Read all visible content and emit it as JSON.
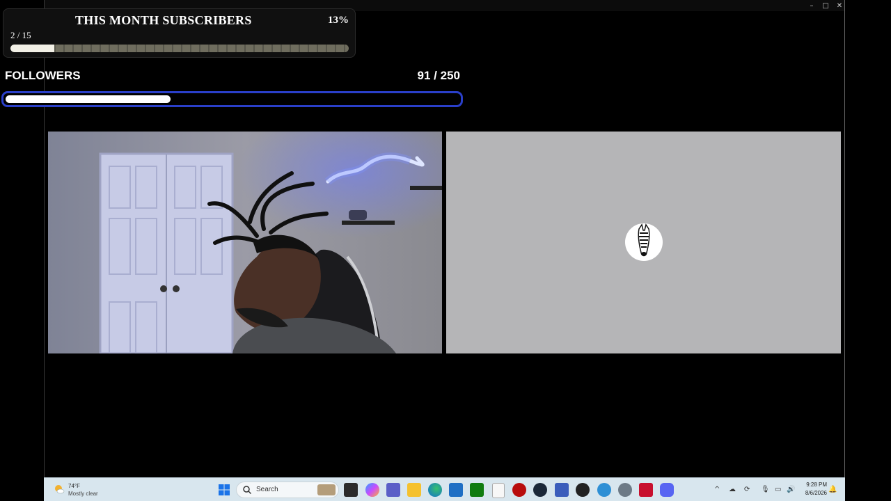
{
  "window": {
    "controls": {
      "minimize": "–",
      "maximize": "□",
      "close": "✕"
    }
  },
  "subscribers": {
    "title": "THIS MONTH SUBSCRIBERS",
    "percent": "13%",
    "count": "2 / 15",
    "progress": 0.13
  },
  "followers": {
    "label": "FOLLOWERS",
    "count": "91 / 250",
    "progress": 0.364
  },
  "colors": {
    "followers_border": "#2a3fc9",
    "guest_bg": "#b5b5b7",
    "taskbar_bg": "#d8e6ee",
    "neon_sign": "#8fb0ff"
  },
  "taskbar": {
    "weather": {
      "temp": "74°F",
      "desc": "Mostly clear",
      "icon": "moon-cloud-icon"
    },
    "search_placeholder": "Search",
    "apps": [
      "windows-start-icon",
      "search-icon",
      "widgets-icon",
      "task-view-icon",
      "copilot-icon",
      "teams-icon",
      "file-explorer-icon",
      "edge-icon",
      "store-icon",
      "xbox-icon",
      "notepad-icon",
      "record-icon",
      "steam-icon",
      "remote-icon",
      "obs-icon",
      "feedback-icon",
      "settings-icon",
      "mcafee-icon",
      "discord-icon"
    ],
    "clock": {
      "time": "9:28 PM",
      "date": "8/6/2026"
    }
  }
}
